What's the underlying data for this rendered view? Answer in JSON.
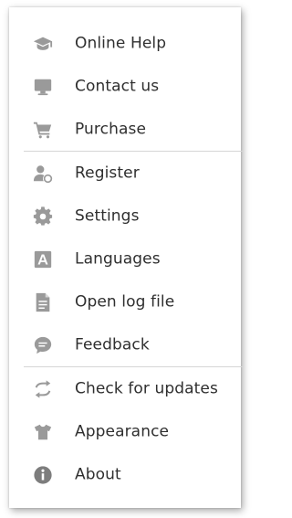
{
  "colors": {
    "icon": "#9a9a9a",
    "icon_dark": "#7d7d7d",
    "text": "#2f2f2f",
    "separator": "#d6d6d6",
    "background": "#ffffff"
  },
  "menu": {
    "items": [
      {
        "label": "Online Help",
        "icon": "graduation-cap-icon"
      },
      {
        "label": "Contact us",
        "icon": "monitor-icon"
      },
      {
        "label": "Purchase",
        "icon": "shopping-cart-icon"
      },
      {
        "label": "Register",
        "icon": "user-register-icon"
      },
      {
        "label": "Settings",
        "icon": "gear-icon"
      },
      {
        "label": "Languages",
        "icon": "language-a-icon"
      },
      {
        "label": "Open log file",
        "icon": "document-icon"
      },
      {
        "label": "Feedback",
        "icon": "chat-bubble-icon"
      },
      {
        "label": "Check for updates",
        "icon": "refresh-icon"
      },
      {
        "label": "Appearance",
        "icon": "tshirt-icon"
      },
      {
        "label": "About",
        "icon": "info-icon"
      }
    ]
  }
}
